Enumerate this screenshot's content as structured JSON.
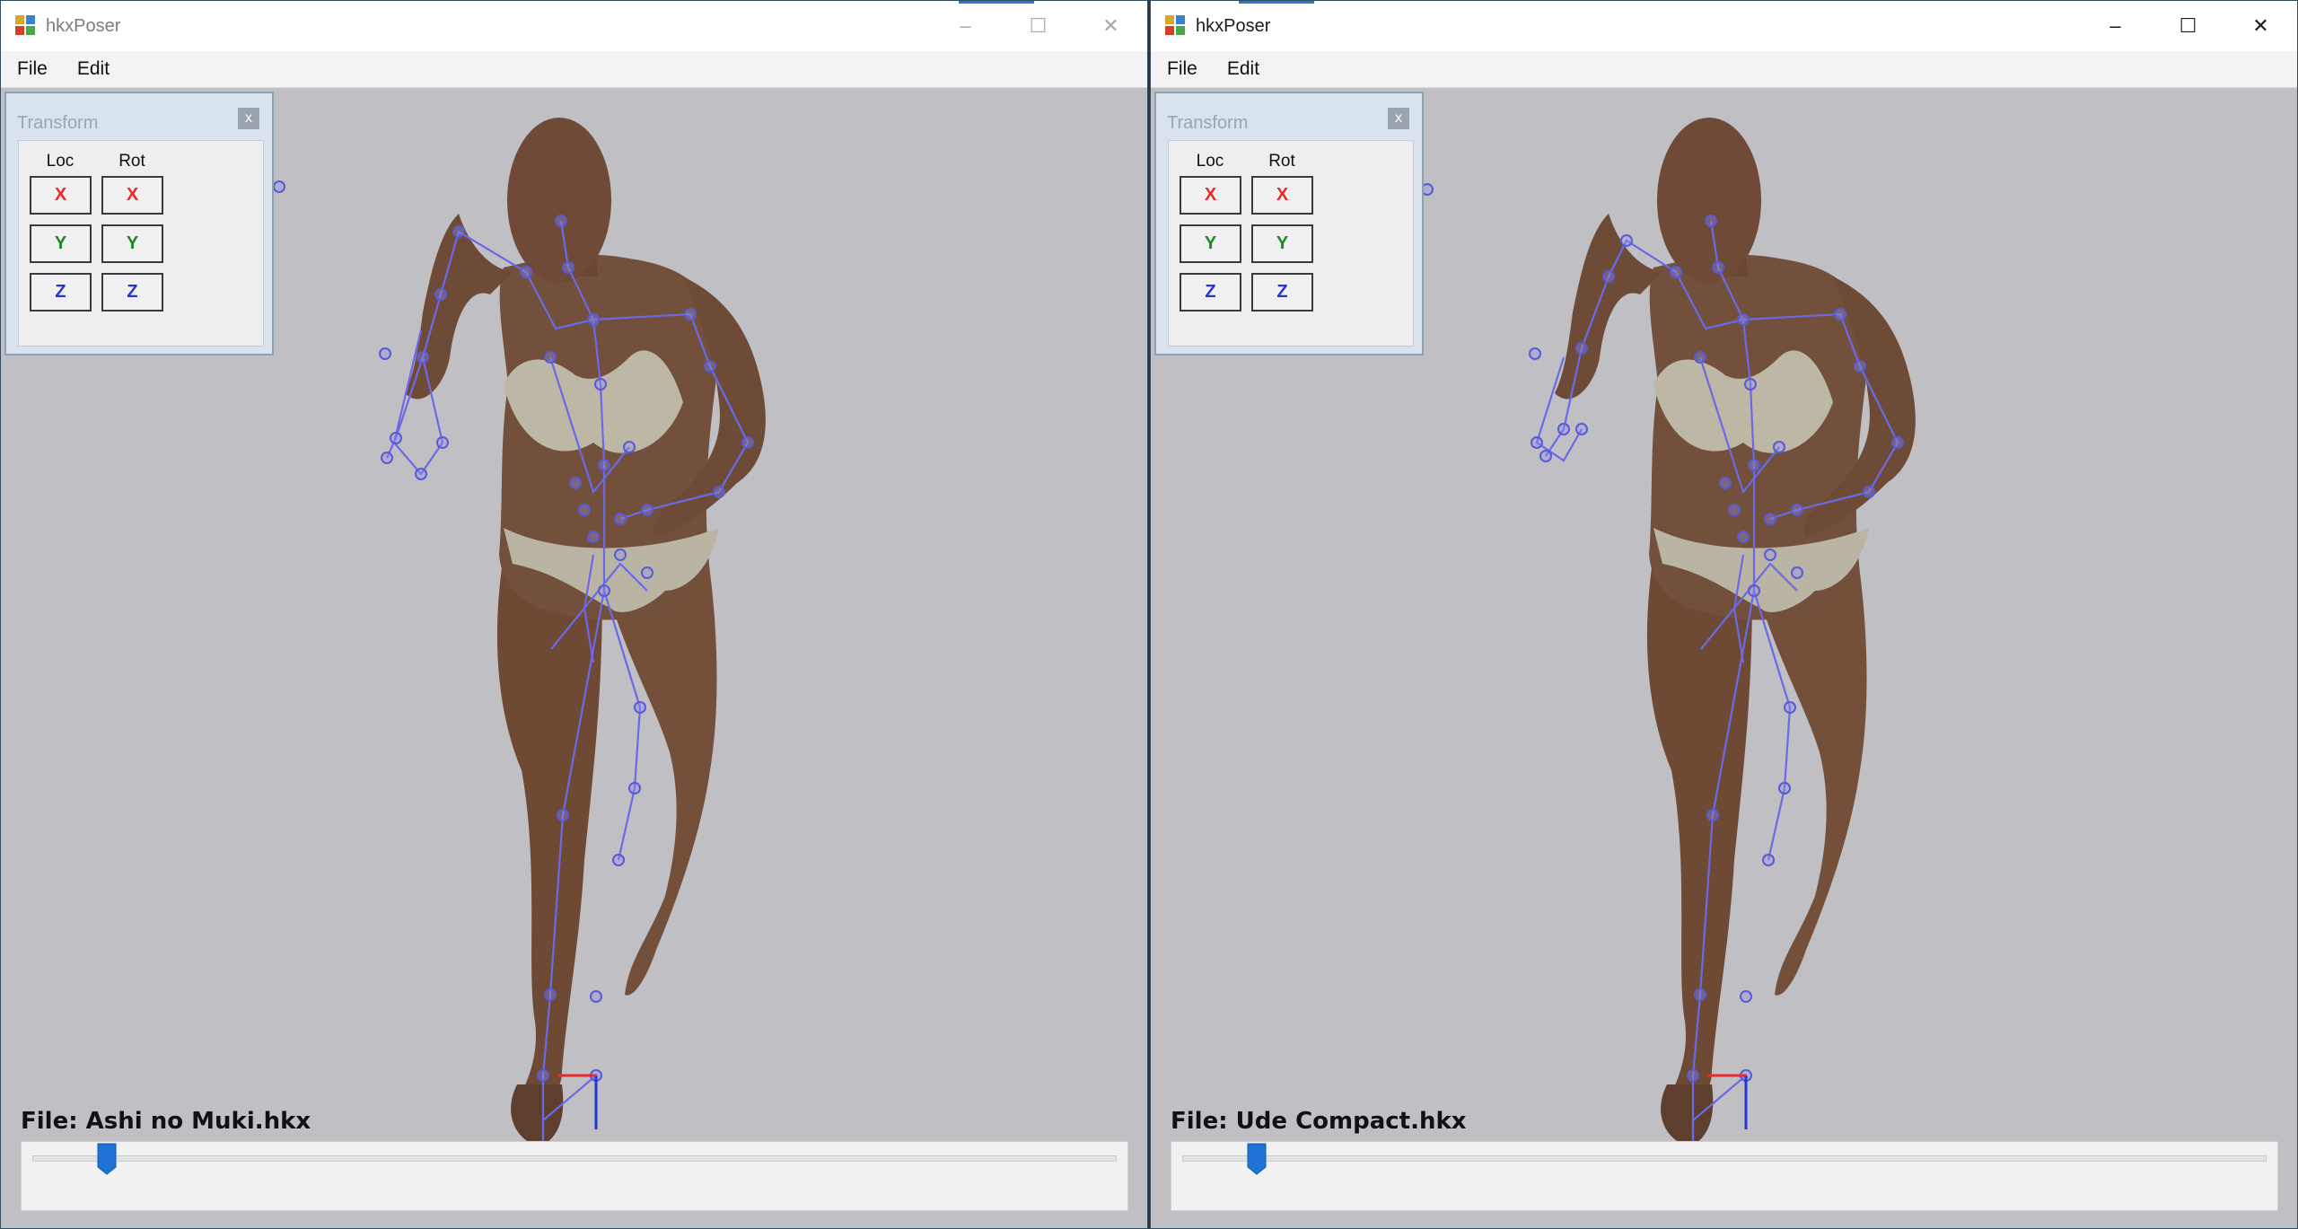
{
  "colors": {
    "viewport_bg": "#c0bfc3",
    "skeleton": "#6a6ae6",
    "axis_x": "#e52b2b",
    "axis_y": "#1d8a1d",
    "axis_z": "#2534d2",
    "slider_thumb": "#1f73d6"
  },
  "windows": [
    {
      "title": "hkxPoser",
      "state": "inactive",
      "controls": {
        "minimize": "–",
        "maximize": "☐",
        "close": "✕"
      },
      "menu": [
        {
          "label": "File"
        },
        {
          "label": "Edit"
        }
      ],
      "transform": {
        "title": "Transform",
        "close_label": "x",
        "loc_label": "Loc",
        "rot_label": "Rot",
        "axes": [
          "X",
          "Y",
          "Z"
        ]
      },
      "file_label": "File: Ashi no Muki.hkx",
      "slider_position": 0.069
    },
    {
      "title": "hkxPoser",
      "state": "active",
      "controls": {
        "minimize": "–",
        "maximize": "☐",
        "close": "✕"
      },
      "menu": [
        {
          "label": "File"
        },
        {
          "label": "Edit"
        }
      ],
      "transform": {
        "title": "Transform",
        "close_label": "x",
        "loc_label": "Loc",
        "rot_label": "Rot",
        "axes": [
          "X",
          "Y",
          "Z"
        ]
      },
      "file_label": "File: Ude Compact.hkx",
      "slider_position": 0.069
    }
  ]
}
